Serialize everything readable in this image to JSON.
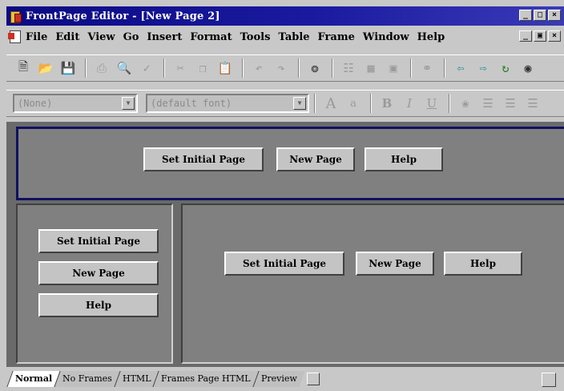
{
  "window": {
    "title": "FrontPage Editor - [New Page 2]",
    "controls": [
      "_",
      "□",
      "×"
    ],
    "mdi_controls": [
      "_",
      "▣",
      "×"
    ]
  },
  "menu": [
    "File",
    "Edit",
    "View",
    "Go",
    "Insert",
    "Format",
    "Tools",
    "Table",
    "Frame",
    "Window",
    "Help"
  ],
  "format_toolbar": {
    "style_value": "(None)",
    "font_value": "(default font)",
    "buttons": [
      "A",
      "a",
      "B",
      "I",
      "U"
    ]
  },
  "frames": {
    "top": {
      "buttons": [
        "Set Initial Page",
        "New Page",
        "Help"
      ]
    },
    "left": {
      "buttons": [
        "Set Initial Page",
        "New Page",
        "Help"
      ]
    },
    "right": {
      "buttons": [
        "Set Initial Page",
        "New Page",
        "Help"
      ]
    }
  },
  "tabs": [
    "Normal",
    "No Frames",
    "HTML",
    "Frames Page HTML",
    "Preview"
  ],
  "colors": {
    "title_bar": "#0a0a84",
    "frame_background": "#808080",
    "selected_frame_border": "#101060"
  }
}
